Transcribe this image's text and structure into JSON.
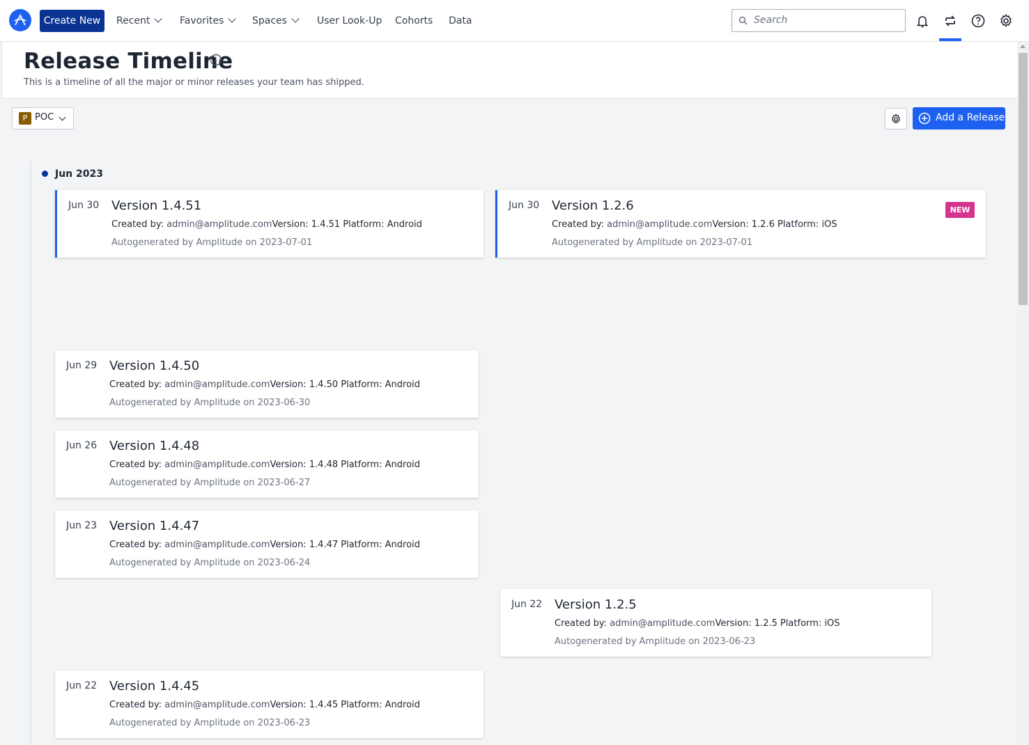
{
  "nav": {
    "create_label": "Create New",
    "items": [
      {
        "label": "Recent",
        "dropdown": true
      },
      {
        "label": "Favorites",
        "dropdown": true
      },
      {
        "label": "Spaces",
        "dropdown": true
      },
      {
        "label": "User Look-Up",
        "dropdown": false
      },
      {
        "label": "Cohorts",
        "dropdown": false
      },
      {
        "label": "Data",
        "dropdown": false
      }
    ],
    "search_placeholder": "Search",
    "icons": [
      "bell-icon",
      "releases-icon",
      "help-icon",
      "settings-icon"
    ],
    "accent": "#1e61f0",
    "create_color": "#0b3393"
  },
  "header": {
    "title": "Release Timeline",
    "subtitle": "This is a timeline of all the major or minor releases your team has shipped."
  },
  "toolbar": {
    "project_badge": "P",
    "project_label": "POC",
    "add_label": "Add a Release"
  },
  "timeline": {
    "month": "Jun 2023",
    "created_by_label": "Created by:",
    "version_label": "Version:",
    "platform_label": "Platform:",
    "new_badge": "NEW",
    "releases": [
      {
        "date": "Jun 30",
        "title": "Version 1.4.51",
        "author": "admin@amplitude.com",
        "version": "1.4.51",
        "platform": "Android",
        "auto": "Autogenerated by Amplitude on 2023-07-01"
      },
      {
        "date": "Jun 30",
        "title": "Version 1.2.6",
        "author": "admin@amplitude.com",
        "version": "1.2.6",
        "platform": "iOS",
        "auto": "Autogenerated by Amplitude on 2023-07-01"
      },
      {
        "date": "Jun 29",
        "title": "Version 1.4.50",
        "author": "admin@amplitude.com",
        "version": "1.4.50",
        "platform": "Android",
        "auto": "Autogenerated by Amplitude on 2023-06-30"
      },
      {
        "date": "Jun 26",
        "title": "Version 1.4.48",
        "author": "admin@amplitude.com",
        "version": "1.4.48",
        "platform": "Android",
        "auto": "Autogenerated by Amplitude on 2023-06-27"
      },
      {
        "date": "Jun 23",
        "title": "Version 1.4.47",
        "author": "admin@amplitude.com",
        "version": "1.4.47",
        "platform": "Android",
        "auto": "Autogenerated by Amplitude on 2023-06-24"
      },
      {
        "date": "Jun 22",
        "title": "Version 1.2.5",
        "author": "admin@amplitude.com",
        "version": "1.2.5",
        "platform": "iOS",
        "auto": "Autogenerated by Amplitude on 2023-06-23"
      },
      {
        "date": "Jun 22",
        "title": "Version 1.4.45",
        "author": "admin@amplitude.com",
        "version": "1.4.45",
        "platform": "Android",
        "auto": "Autogenerated by Amplitude on 2023-06-23"
      }
    ]
  }
}
